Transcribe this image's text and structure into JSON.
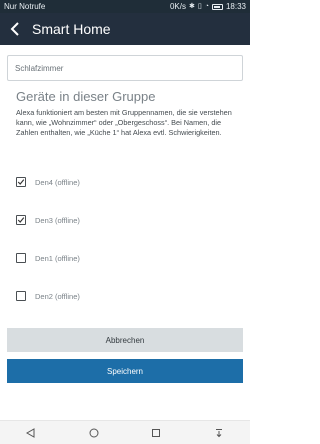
{
  "status_bar": {
    "carrier": "Nur Notrufe",
    "speed": "0K/s",
    "time": "18:33"
  },
  "app_bar": {
    "title": "Smart Home"
  },
  "form": {
    "group_name_value": "Schlafzimmer"
  },
  "section": {
    "title": "Geräte in dieser Gruppe",
    "description": "Alexa funktioniert am besten mit Gruppennamen, die sie verstehen kann, wie „Wohnzimmer“ oder „Obergeschoss“. Bei Namen, die Zahlen enthalten, wie „Küche 1“ hat Alexa evtl. Schwierigkeiten."
  },
  "devices": [
    {
      "label": "Den4 (offline)",
      "checked": true
    },
    {
      "label": "Den3 (offline)",
      "checked": true
    },
    {
      "label": "Den1 (offline)",
      "checked": false
    },
    {
      "label": "Den2 (offline)",
      "checked": false
    }
  ],
  "actions": {
    "cancel_label": "Abbrechen",
    "save_label": "Speichern"
  },
  "colors": {
    "app_bar": "#232f3e",
    "primary_button": "#1d6ea8",
    "secondary_button": "#d8dde0"
  }
}
